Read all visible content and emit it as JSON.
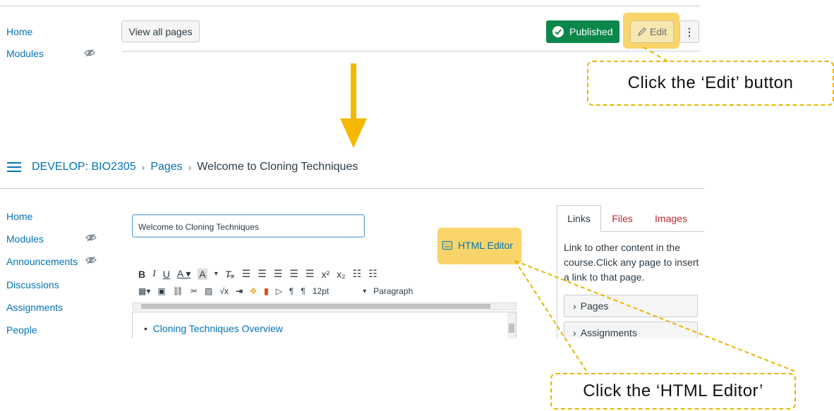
{
  "top": {
    "nav": [
      "Home",
      "Modules"
    ],
    "view_all_pages": "View all pages",
    "published": "Published",
    "edit": "Edit",
    "callout": "Click the ‘Edit’ button"
  },
  "breadcrumb": {
    "course": "DEVELOP: BIO2305",
    "pages": "Pages",
    "current": "Welcome to Cloning Techniques"
  },
  "sidebar": {
    "items": [
      {
        "label": "Home"
      },
      {
        "label": "Modules"
      },
      {
        "label": "Announcements"
      },
      {
        "label": "Discussions"
      },
      {
        "label": "Assignments"
      },
      {
        "label": "People"
      }
    ]
  },
  "editor": {
    "title_value": "Welcome to Cloning Techniques",
    "html_editor": "HTML Editor",
    "font_size": "12pt",
    "block_format": "Paragraph",
    "content_item": "Cloning Techniques Overview"
  },
  "right_panel": {
    "tabs": [
      "Links",
      "Files",
      "Images"
    ],
    "description": "Link to other content in the course.Click any page to insert a link to that page.",
    "sections": [
      "Pages",
      "Assignments"
    ]
  },
  "callout2": "Click the ‘HTML Editor’",
  "colors": {
    "link": "#0374b5",
    "published_green": "#0b874b",
    "highlight": "#f9d46a",
    "arrow": "#f5b800",
    "tab_red": "#c0272d"
  }
}
